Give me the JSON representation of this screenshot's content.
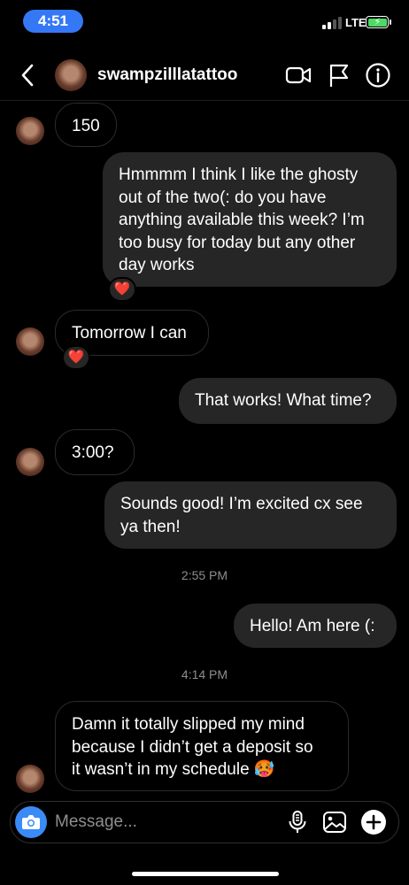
{
  "status_bar": {
    "time": "4:51",
    "network": "LTE",
    "battery_color": "#4cd964",
    "time_pill_color": "#3478f6"
  },
  "header": {
    "username": "swampzilllatattoo",
    "icons": [
      "chevron-left-icon",
      "video-camera-icon",
      "flag-icon",
      "info-icon"
    ]
  },
  "messages": [
    {
      "direction": "in",
      "text": "150"
    },
    {
      "direction": "out",
      "lines": [
        "Hmmmm I think I like the ghosty",
        "out of the two(: do you have",
        "anything available this week? I’m",
        "too busy for today but any other",
        "day works"
      ],
      "reaction": "❤️"
    },
    {
      "direction": "in",
      "text": "Tomorrow I can",
      "reaction": "❤️"
    },
    {
      "direction": "out",
      "text": "That works! What time?"
    },
    {
      "direction": "in",
      "text": "3:00?"
    },
    {
      "direction": "out",
      "lines": [
        "Sounds good! I’m excited cx see",
        "ya then!"
      ]
    },
    {
      "type": "timestamp",
      "text": "2:55 PM"
    },
    {
      "direction": "out",
      "text": "Hello! Am here (:"
    },
    {
      "type": "timestamp",
      "text": "4:14 PM"
    },
    {
      "direction": "in",
      "lines": [
        "Damn it totally slipped my mind",
        "because I didn’t get a deposit so",
        "it wasn’t in my schedule 🥵"
      ]
    }
  ],
  "composer": {
    "placeholder": "Message...",
    "icons": [
      "camera-icon",
      "microphone-icon",
      "gallery-icon",
      "plus-icon"
    ]
  },
  "colors": {
    "outgoing_bubble": "#262626",
    "incoming_border": "#2b2b2b",
    "background": "#000000",
    "accent": "#3a8bf6"
  }
}
